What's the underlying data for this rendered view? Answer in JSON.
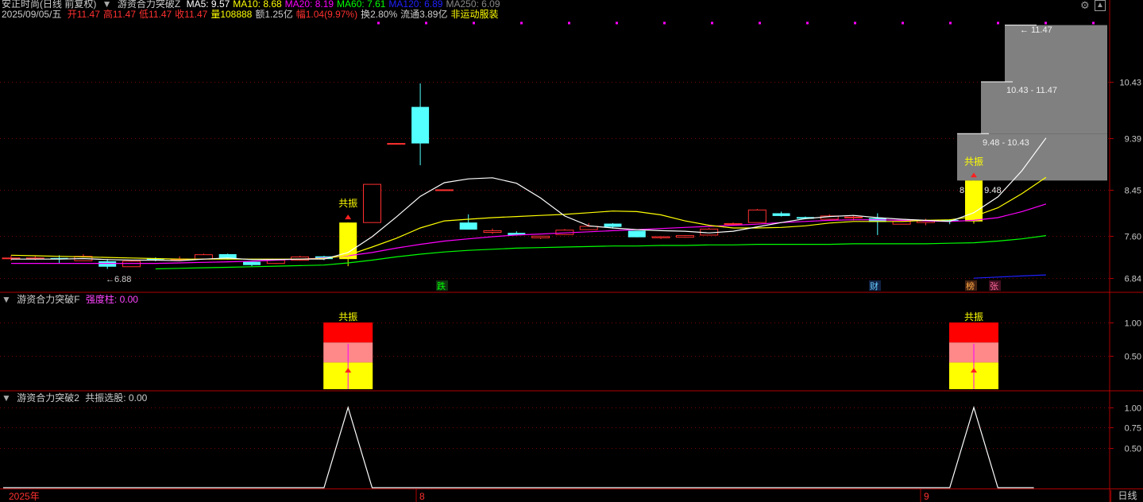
{
  "header": {
    "stock": "安正时尚(日线 前复权)",
    "indicator_name": "游资合力突破Z",
    "ma": [
      {
        "label": "MA5: 9.57",
        "color": "#ffffff"
      },
      {
        "label": "MA10: 8.68",
        "color": "#ffff00"
      },
      {
        "label": "MA20: 8.19",
        "color": "#ff00ff"
      },
      {
        "label": "MA60: 7.61",
        "color": "#00ff00"
      },
      {
        "label": "MA120: 6.89",
        "color": "#2020ff"
      },
      {
        "label": "MA250: 6.09",
        "color": "#888888"
      }
    ],
    "date": "2025/09/05/五",
    "quote": [
      {
        "label": "开11.47",
        "color": "#ff3030"
      },
      {
        "label": "高11.47",
        "color": "#ff3030"
      },
      {
        "label": "低11.47",
        "color": "#ff3030"
      },
      {
        "label": "收11.47",
        "color": "#ff3030"
      },
      {
        "label": "量108888",
        "color": "#ffff00"
      },
      {
        "label": "额1.25亿",
        "color": "#cccccc"
      },
      {
        "label": "幅1.04(9.97%)",
        "color": "#ff3030"
      },
      {
        "label": "换2.80%",
        "color": "#cccccc"
      },
      {
        "label": "流通3.89亿",
        "color": "#cccccc"
      },
      {
        "label": "非运动服装",
        "color": "#ffff00"
      }
    ]
  },
  "price_axis": [
    "10.43",
    "9.39",
    "8.45",
    "7.60",
    "6.84"
  ],
  "chip_labels": [
    "11.47",
    "10.43 - 11.47",
    "9.48 - 10.43",
    "8.62 - 9.48"
  ],
  "signals": {
    "resonance": "共振",
    "low_marker": "6.88",
    "events": [
      {
        "label": "跌",
        "color": "#00ff00",
        "bg": "#113311"
      },
      {
        "label": "财",
        "color": "#66ccff",
        "bg": "#112244"
      },
      {
        "label": "榜",
        "color": "#ffaa44",
        "bg": "#442211"
      },
      {
        "label": "张",
        "color": "#ff6699",
        "bg": "#441122"
      }
    ]
  },
  "panel2": {
    "title": "游资合力突破F",
    "metric": "强度柱: 0.00",
    "axis": [
      "1.00",
      "0.50"
    ],
    "bar_label": "共振",
    "signal_values": [
      1.0,
      1.0
    ]
  },
  "panel3": {
    "title": "游资合力突破2",
    "metric": "共振选股: 0.00",
    "axis": [
      "1.00",
      "0.75",
      "0.50"
    ],
    "signal_values": [
      1.0,
      1.0
    ]
  },
  "time_axis": [
    "2025年",
    "8",
    "9"
  ],
  "period": "日线",
  "colors": {
    "up": "#ff3030",
    "down": "#54ffff",
    "grid": "#7a0000",
    "frame": "#b00000",
    "signal_bar": "#ffff00"
  },
  "chart_data": {
    "type": "candlestick",
    "candles": [
      {
        "o": 7.2,
        "h": 7.25,
        "l": 7.15,
        "c": 7.2
      },
      {
        "o": 7.19,
        "h": 7.25,
        "l": 7.16,
        "c": 7.2
      },
      {
        "o": 7.2,
        "h": 7.25,
        "l": 7.1,
        "c": 7.19
      },
      {
        "o": 7.15,
        "h": 7.27,
        "l": 7.15,
        "c": 7.23
      },
      {
        "o": 7.14,
        "h": 7.18,
        "l": 7.0,
        "c": 7.04
      },
      {
        "o": 7.04,
        "h": 7.16,
        "l": 7.04,
        "c": 7.14
      },
      {
        "o": 7.19,
        "h": 7.21,
        "l": 7.14,
        "c": 7.17
      },
      {
        "o": 7.18,
        "h": 7.23,
        "l": 7.15,
        "c": 7.18
      },
      {
        "o": 7.18,
        "h": 7.28,
        "l": 7.17,
        "c": 7.26
      },
      {
        "o": 7.27,
        "h": 7.28,
        "l": 7.17,
        "c": 7.18
      },
      {
        "o": 7.13,
        "h": 7.14,
        "l": 7.05,
        "c": 7.07
      },
      {
        "o": 7.1,
        "h": 7.16,
        "l": 7.09,
        "c": 7.16
      },
      {
        "o": 7.16,
        "h": 7.24,
        "l": 7.15,
        "c": 7.22
      },
      {
        "o": 7.23,
        "h": 7.24,
        "l": 7.16,
        "c": 7.18
      },
      {
        "o": 7.18,
        "h": 7.85,
        "l": 7.05,
        "c": 7.85
      },
      {
        "o": 7.85,
        "h": 8.55,
        "l": 7.85,
        "c": 8.55
      },
      {
        "o": 9.3,
        "h": 9.3,
        "l": 9.3,
        "c": 9.3
      },
      {
        "o": 9.97,
        "h": 10.4,
        "l": 8.9,
        "c": 9.3
      },
      {
        "o": 8.45,
        "h": 8.45,
        "l": 8.45,
        "c": 8.45
      },
      {
        "o": 7.85,
        "h": 8.0,
        "l": 7.72,
        "c": 7.72
      },
      {
        "o": 7.67,
        "h": 7.74,
        "l": 7.64,
        "c": 7.7
      },
      {
        "o": 7.66,
        "h": 7.69,
        "l": 7.61,
        "c": 7.62
      },
      {
        "o": 7.57,
        "h": 7.6,
        "l": 7.55,
        "c": 7.6
      },
      {
        "o": 7.63,
        "h": 7.73,
        "l": 7.63,
        "c": 7.71
      },
      {
        "o": 7.72,
        "h": 7.84,
        "l": 7.72,
        "c": 7.78
      },
      {
        "o": 7.83,
        "h": 7.84,
        "l": 7.74,
        "c": 7.77
      },
      {
        "o": 7.7,
        "h": 7.7,
        "l": 7.58,
        "c": 7.58
      },
      {
        "o": 7.57,
        "h": 7.6,
        "l": 7.55,
        "c": 7.59
      },
      {
        "o": 7.58,
        "h": 7.62,
        "l": 7.57,
        "c": 7.61
      },
      {
        "o": 7.62,
        "h": 7.75,
        "l": 7.62,
        "c": 7.73
      },
      {
        "o": 7.83,
        "h": 7.85,
        "l": 7.8,
        "c": 7.83
      },
      {
        "o": 7.85,
        "h": 8.1,
        "l": 7.85,
        "c": 8.08
      },
      {
        "o": 8.02,
        "h": 8.05,
        "l": 7.96,
        "c": 7.97
      },
      {
        "o": 7.95,
        "h": 7.96,
        "l": 7.91,
        "c": 7.92
      },
      {
        "o": 7.91,
        "h": 8.0,
        "l": 7.91,
        "c": 7.97
      },
      {
        "o": 7.95,
        "h": 7.98,
        "l": 7.89,
        "c": 7.95
      },
      {
        "o": 7.93,
        "h": 8.02,
        "l": 7.62,
        "c": 7.86
      },
      {
        "o": 7.82,
        "h": 7.88,
        "l": 7.82,
        "c": 7.87
      },
      {
        "o": 7.85,
        "h": 7.92,
        "l": 7.8,
        "c": 7.88
      },
      {
        "o": 7.9,
        "h": 7.91,
        "l": 7.82,
        "c": 7.88
      },
      {
        "o": 7.87,
        "h": 8.62,
        "l": 7.83,
        "c": 8.62
      }
    ],
    "ma5": [
      7.18,
      7.18,
      7.18,
      7.19,
      7.17,
      7.16,
      7.16,
      7.15,
      7.18,
      7.2,
      7.17,
      7.17,
      7.18,
      7.18,
      7.3,
      7.59,
      7.95,
      8.33,
      8.58,
      8.65,
      8.67,
      8.57,
      8.3,
      7.97,
      7.79,
      7.75,
      7.72,
      7.7,
      7.69,
      7.66,
      7.69,
      7.77,
      7.85,
      7.92,
      7.96,
      7.98,
      7.94,
      7.91,
      7.89,
      7.87,
      8.03,
      8.32,
      8.8,
      9.4
    ],
    "ma10": [
      7.25,
      7.24,
      7.23,
      7.22,
      7.21,
      7.2,
      7.19,
      7.18,
      7.18,
      7.18,
      7.18,
      7.18,
      7.18,
      7.19,
      7.25,
      7.4,
      7.56,
      7.75,
      7.88,
      7.91,
      7.94,
      7.96,
      7.98,
      8.0,
      8.03,
      8.06,
      8.05,
      7.99,
      7.88,
      7.8,
      7.75,
      7.75,
      7.76,
      7.79,
      7.84,
      7.87,
      7.87,
      7.87,
      7.89,
      7.9,
      7.96,
      8.12,
      8.38,
      8.68
    ],
    "ma20": [
      7.1,
      7.1,
      7.1,
      7.1,
      7.1,
      7.1,
      7.1,
      7.11,
      7.12,
      7.13,
      7.14,
      7.16,
      7.18,
      7.2,
      7.24,
      7.3,
      7.38,
      7.45,
      7.51,
      7.55,
      7.59,
      7.62,
      7.64,
      7.66,
      7.68,
      7.7,
      7.72,
      7.74,
      7.76,
      7.78,
      7.8,
      7.82,
      7.85,
      7.87,
      7.89,
      7.9,
      7.9,
      7.89,
      7.88,
      7.87,
      7.89,
      7.94,
      8.05,
      8.19
    ],
    "ma60": [
      null,
      null,
      null,
      null,
      null,
      null,
      7.0,
      7.01,
      7.02,
      7.03,
      7.04,
      7.05,
      7.06,
      7.07,
      7.11,
      7.16,
      7.22,
      7.27,
      7.31,
      7.34,
      7.36,
      7.38,
      7.39,
      7.4,
      7.41,
      7.42,
      7.42,
      7.43,
      7.43,
      7.44,
      7.44,
      7.45,
      7.45,
      7.45,
      7.45,
      7.46,
      7.46,
      7.46,
      7.46,
      7.47,
      7.48,
      7.51,
      7.55,
      7.61
    ],
    "ma120": [
      null,
      null,
      null,
      null,
      null,
      null,
      null,
      null,
      null,
      null,
      null,
      null,
      null,
      null,
      null,
      null,
      null,
      null,
      null,
      null,
      null,
      null,
      null,
      null,
      null,
      null,
      null,
      null,
      null,
      null,
      null,
      null,
      null,
      null,
      null,
      null,
      null,
      null,
      null,
      null,
      6.83,
      6.85,
      6.87,
      6.89
    ]
  }
}
